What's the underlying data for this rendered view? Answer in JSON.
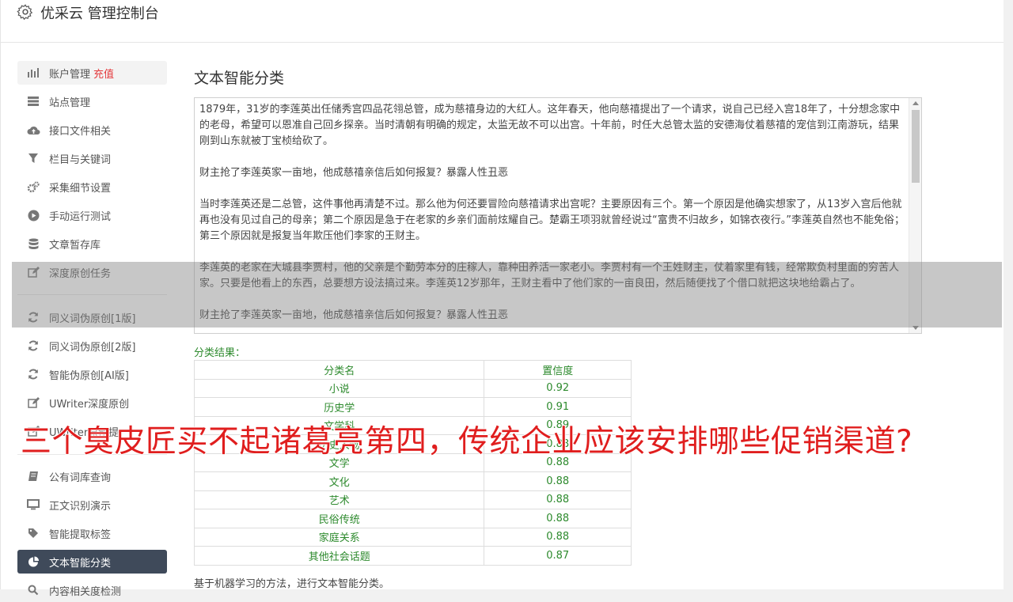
{
  "header": {
    "title": "优采云 管理控制台"
  },
  "sidebar": {
    "items": [
      {
        "label": "账户管理",
        "extra": "充值",
        "icon": "bar-chart-icon"
      },
      {
        "label": "站点管理",
        "icon": "server-icon"
      },
      {
        "label": "接口文件相关",
        "icon": "cloud-upload-icon"
      },
      {
        "label": "栏目与关键词",
        "icon": "filter-icon"
      },
      {
        "label": "采集细节设置",
        "icon": "gears-icon"
      },
      {
        "label": "手动运行测试",
        "icon": "play-circle-icon"
      },
      {
        "label": "文章暂存库",
        "icon": "database-icon"
      },
      {
        "label": "深度原创任务",
        "icon": "edit-icon"
      },
      {
        "label": "同义词伪原创[1版]",
        "icon": "refresh-icon"
      },
      {
        "label": "同义词伪原创[2版]",
        "icon": "refresh-icon"
      },
      {
        "label": "智能伪原创[AI版]",
        "icon": "refresh-icon"
      },
      {
        "label": "UWriter深度原创",
        "icon": "edit-icon"
      },
      {
        "label": "UWriter原创提",
        "icon": "edit-icon"
      },
      {
        "label": "公有词库查询",
        "icon": "book-icon"
      },
      {
        "label": "正文识别演示",
        "icon": "monitor-icon"
      },
      {
        "label": "智能提取标签",
        "icon": "tag-icon"
      },
      {
        "label": "文本智能分类",
        "icon": "pie-chart-icon"
      },
      {
        "label": "内容相关度检测",
        "icon": "search-icon"
      }
    ]
  },
  "main": {
    "title": "文本智能分类",
    "text_paragraphs": [
      "1879年，31岁的李莲英出任储秀宫四品花翎总管，成为慈禧身边的大红人。这年春天，他向慈禧提出了一个请求，说自己已经入宫18年了，十分想念家中的老母，希望可以恩准自己回乡探亲。当时清朝有明确的规定，太监无故不可以出宫。十年前，时任大总管太监的安德海仗着慈禧的宠信到江南游玩，结果刚到山东就被丁宝桢给砍了。",
      "财主抢了李莲英家一亩地，他成慈禧亲信后如何报复？暴露人性丑恶",
      "当时李莲英还是二总管，这件事他再清楚不过。那么他为何还要冒险向慈禧请求出宫呢？主要原因有三个。第一个原因是他确实想家了，从13岁入宫后他就再也没有见过自己的母亲；第二个原因是急于在老家的乡亲们面前炫耀自己。楚霸王项羽就曾经说过“富贵不归故乡，如锦衣夜行。”李莲英自然也不能免俗；第三个原因就是报复当年欺压他们李家的王财主。",
      "李莲英的老家在大城县李贾村，他的父亲是个勤劳本分的庄稼人，靠种田养活一家老小。李贾村有一个王姓财主，仗着家里有钱，经常欺负村里面的穷苦人家。只要是他看上的东西，总要想方设法搞过来。李莲英12岁那年，王财主看中了他们家的一亩良田，然后随便找了个借口就把这块地给霸占了。",
      "财主抢了李莲英家一亩地，他成慈禧亲信后如何报复？暴露人性丑恶"
    ],
    "result_label": "分类结果：",
    "table_headers": [
      "分类名",
      "置信度"
    ],
    "table_rows": [
      [
        "小说",
        "0.92"
      ],
      [
        "历史学",
        "0.91"
      ],
      [
        "文学科",
        "0.89"
      ],
      [
        "历史人物",
        "0.88"
      ],
      [
        "文学",
        "0.88"
      ],
      [
        "文化",
        "0.88"
      ],
      [
        "艺术",
        "0.88"
      ],
      [
        "民俗传统",
        "0.88"
      ],
      [
        "家庭关系",
        "0.88"
      ],
      [
        "其他社会话题",
        "0.87"
      ]
    ],
    "footnote": "基于机器学习的方法，进行文本智能分类。"
  },
  "overlay": {
    "text": "三个臭皮匠买不起诸葛亮第四，传统企业应该安排哪些促销渠道?"
  },
  "colors": {
    "active_nav": "#3f4a5a",
    "result_green": "#2d8a2d",
    "recharge_red": "#e4393c",
    "overlay_red": "#e01e1e"
  }
}
